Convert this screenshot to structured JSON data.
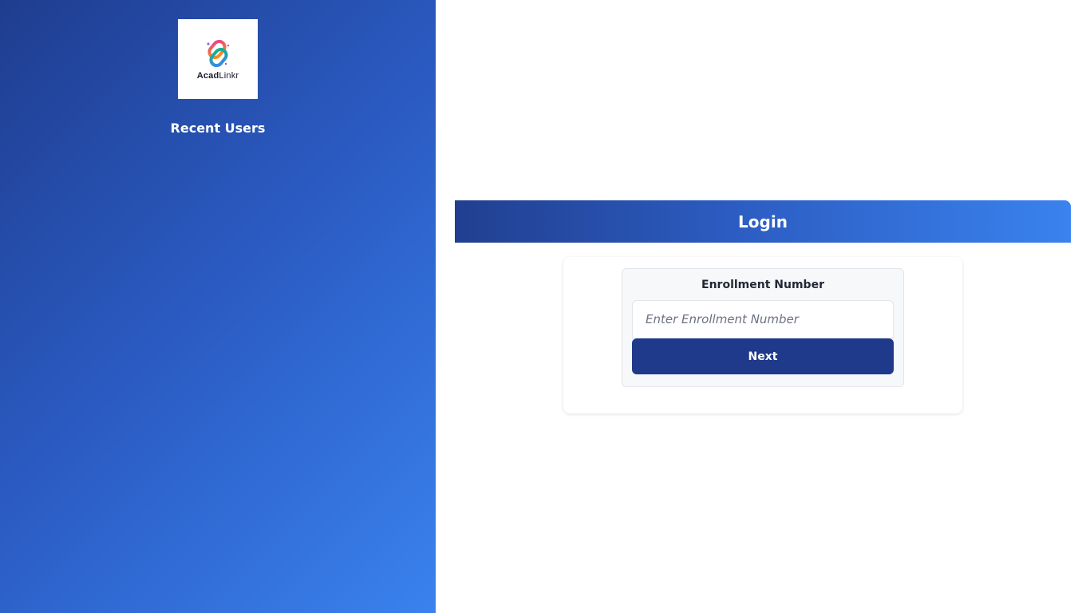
{
  "sidebar": {
    "logo": {
      "icon": "chain-link-icon",
      "text_bold": "Acad",
      "text_regular": "Linkr"
    },
    "recent_users_title": "Recent Users"
  },
  "login": {
    "header_title": "Login",
    "enrollment": {
      "label": "Enrollment Number",
      "value": "",
      "placeholder": "Enter Enrollment Number"
    },
    "next_label": "Next"
  },
  "colors": {
    "sidebar_gradient_start": "#1f3d8f",
    "sidebar_gradient_end": "#3a82ee",
    "button": "#1f3a8a",
    "white": "#ffffff"
  }
}
